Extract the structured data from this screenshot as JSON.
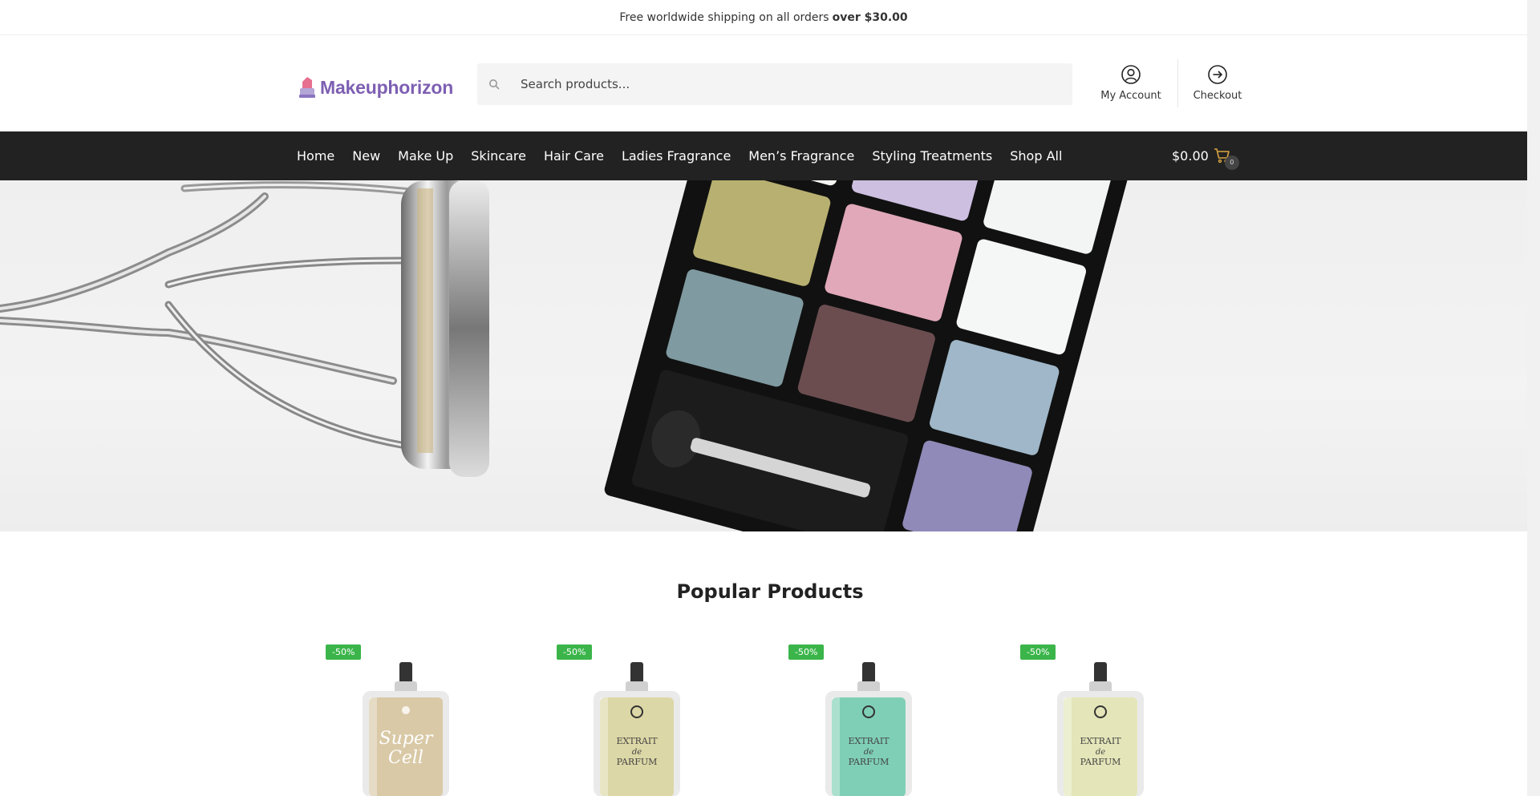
{
  "topbar": {
    "text": "Free worldwide shipping on all orders",
    "bold": "over $30.00"
  },
  "header": {
    "logo_text": "Makeuphorizon",
    "search_placeholder": "Search products...",
    "account_label": "My Account",
    "checkout_label": "Checkout"
  },
  "nav": {
    "items": [
      "Home",
      "New",
      "Make Up",
      "Skincare",
      "Hair Care",
      "Ladies Fragrance",
      "Men’s Fragrance",
      "Styling Treatments",
      "Shop All"
    ],
    "cart_total": "$0.00",
    "cart_count": "0"
  },
  "hero": {
    "image_subject": "eyeshadow-palette-and-eyelash-curler"
  },
  "products_section": {
    "title": "Popular Products",
    "products": [
      {
        "badge": "-50%",
        "liquid_color": "#d9c9a6",
        "label_type": "script",
        "label": "Super Cell"
      },
      {
        "badge": "-50%",
        "liquid_color": "#dcd7a6",
        "label_type": "serif",
        "label": "EXTRAIT de PARFUM"
      },
      {
        "badge": "-50%",
        "liquid_color": "#7fcfb6",
        "label_type": "serif",
        "label": "EXTRAIT de PARFUM"
      },
      {
        "badge": "-50%",
        "liquid_color": "#e4e6b9",
        "label_type": "serif",
        "label": "EXTRAIT de PARFUM"
      }
    ]
  },
  "colors": {
    "nav_bg": "#222222",
    "badge_bg": "#3bb54a",
    "logo": "#7d5fb2",
    "cart_icon": "#d9a441"
  }
}
